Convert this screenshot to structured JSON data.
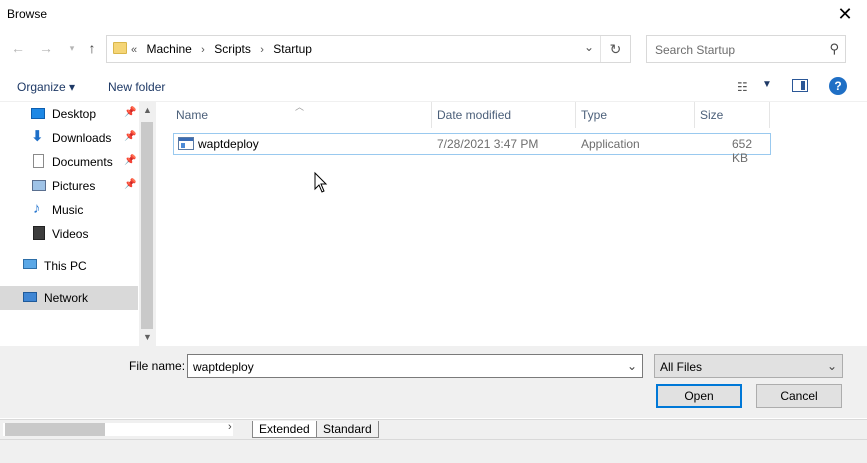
{
  "window": {
    "title": "Browse"
  },
  "address": {
    "prefix": "«",
    "crumbs": [
      "Machine",
      "Scripts",
      "Startup"
    ]
  },
  "search": {
    "placeholder": "Search Startup"
  },
  "toolbar": {
    "organize": "Organize ▾",
    "new_folder": "New folder"
  },
  "sidebar": {
    "items": [
      {
        "label": "Desktop",
        "icon": "desktop-icon",
        "pinned": true
      },
      {
        "label": "Downloads",
        "icon": "downloads-icon",
        "pinned": true
      },
      {
        "label": "Documents",
        "icon": "documents-icon",
        "pinned": true
      },
      {
        "label": "Pictures",
        "icon": "pictures-icon",
        "pinned": true
      },
      {
        "label": "Music",
        "icon": "music-icon",
        "pinned": false
      },
      {
        "label": "Videos",
        "icon": "videos-icon",
        "pinned": false
      },
      {
        "label": "This PC",
        "icon": "this-pc-icon",
        "pinned": false
      },
      {
        "label": "Network",
        "icon": "network-icon",
        "pinned": false,
        "selected": true
      }
    ]
  },
  "columns": {
    "name": "Name",
    "date": "Date modified",
    "type": "Type",
    "size": "Size"
  },
  "files": [
    {
      "name": "waptdeploy",
      "date": "7/28/2021 3:47 PM",
      "type": "Application",
      "size": "652 KB"
    }
  ],
  "footer": {
    "file_name_label": "File name:",
    "file_name_value": "waptdeploy",
    "filter": "All Files",
    "open": "Open",
    "cancel": "Cancel"
  },
  "tabs": [
    "Extended",
    "Standard"
  ],
  "colors": {
    "selection_border": "#99c9ef",
    "accent": "#0078d7"
  }
}
